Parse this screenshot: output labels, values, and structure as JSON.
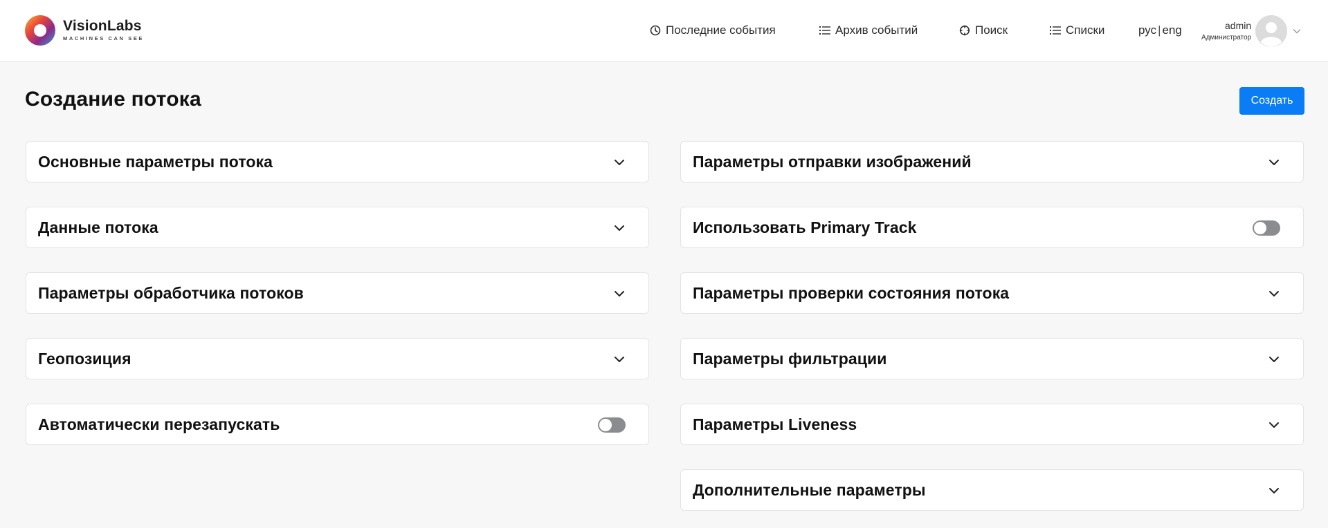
{
  "brand": {
    "name": "VisionLabs",
    "tagline": "MACHINES CAN SEE"
  },
  "nav": {
    "recent": "Последние события",
    "archive": "Архив событий",
    "search": "Поиск",
    "lists": "Списки"
  },
  "lang": {
    "ru": "рус",
    "sep": "|",
    "en": "eng"
  },
  "user": {
    "name": "admin",
    "role": "Администратор"
  },
  "page": {
    "title": "Создание потока",
    "create_label": "Создать"
  },
  "left_panels": [
    {
      "title": "Основные параметры потока",
      "control": "chevron-down-icon"
    },
    {
      "title": "Данные потока",
      "control": "chevron-down-icon"
    },
    {
      "title": "Параметры обработчика потоков",
      "control": "chevron-down-icon"
    },
    {
      "title": "Геопозиция",
      "control": "chevron-down-icon"
    },
    {
      "title": "Автоматически перезапускать",
      "control": "toggle",
      "toggle_on": false
    }
  ],
  "right_panels": [
    {
      "title": "Параметры отправки изображений",
      "control": "chevron-down-icon"
    },
    {
      "title": "Использовать Primary Track",
      "control": "toggle",
      "toggle_on": false
    },
    {
      "title": "Параметры проверки состояния потока",
      "control": "chevron-down-icon"
    },
    {
      "title": "Параметры фильтрации",
      "control": "chevron-down-icon"
    },
    {
      "title": "Параметры Liveness",
      "control": "chevron-down-icon"
    },
    {
      "title": "Дополнительные параметры",
      "control": "chevron-down-icon"
    }
  ],
  "colors": {
    "accent": "#0a7cf5",
    "toggle_off": "#8a8c90",
    "background": "#f7f7f7"
  }
}
